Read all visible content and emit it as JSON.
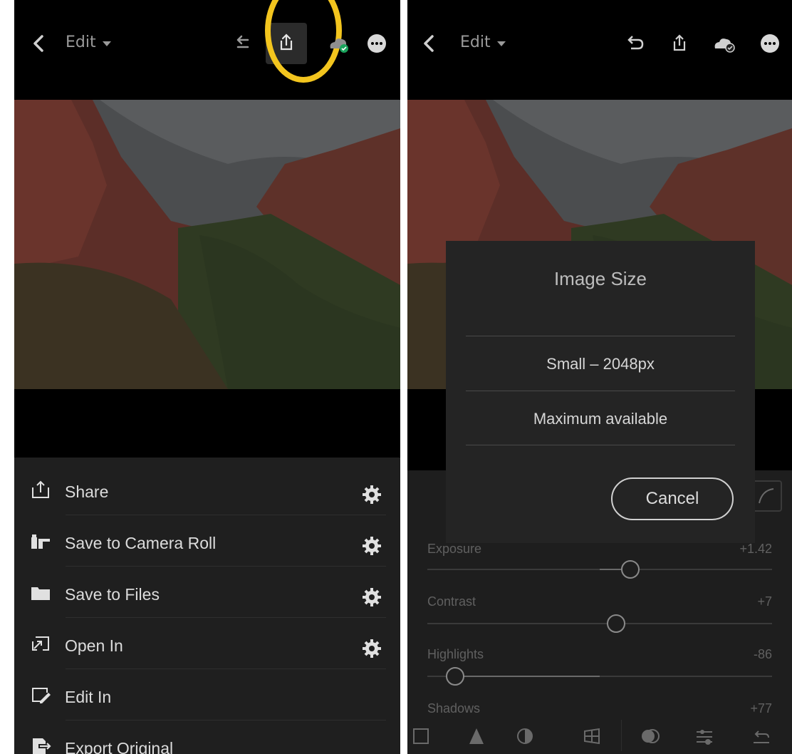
{
  "left": {
    "topbar": {
      "edit_label": "Edit"
    },
    "menu": {
      "items": [
        {
          "label": "Share",
          "icon": "share-icon",
          "has_settings": true
        },
        {
          "label": "Save to Camera Roll",
          "icon": "camera-roll-icon",
          "has_settings": true
        },
        {
          "label": "Save to Files",
          "icon": "folder-icon",
          "has_settings": true
        },
        {
          "label": "Open In",
          "icon": "open-in-icon",
          "has_settings": true
        },
        {
          "label": "Edit In",
          "icon": "edit-in-icon",
          "has_settings": false
        },
        {
          "label": "Export Original",
          "icon": "export-icon",
          "has_settings": false
        }
      ]
    },
    "highlight_color": "#f3c51e"
  },
  "right": {
    "topbar": {
      "edit_label": "Edit"
    },
    "dialog": {
      "title": "Image Size",
      "options": [
        "Small – 2048px",
        "Maximum available"
      ],
      "cancel_label": "Cancel"
    },
    "adjustments": [
      {
        "label": "Exposure",
        "value": "+1.42"
      },
      {
        "label": "Contrast",
        "value": "+7"
      },
      {
        "label": "Highlights",
        "value": "-86"
      },
      {
        "label": "Shadows",
        "value": "+77"
      }
    ]
  },
  "colors": {
    "background": "#000000",
    "sheet": "#1f1f1f",
    "text": "#dcdcdc",
    "cloud_badge": "#1aa35c"
  }
}
